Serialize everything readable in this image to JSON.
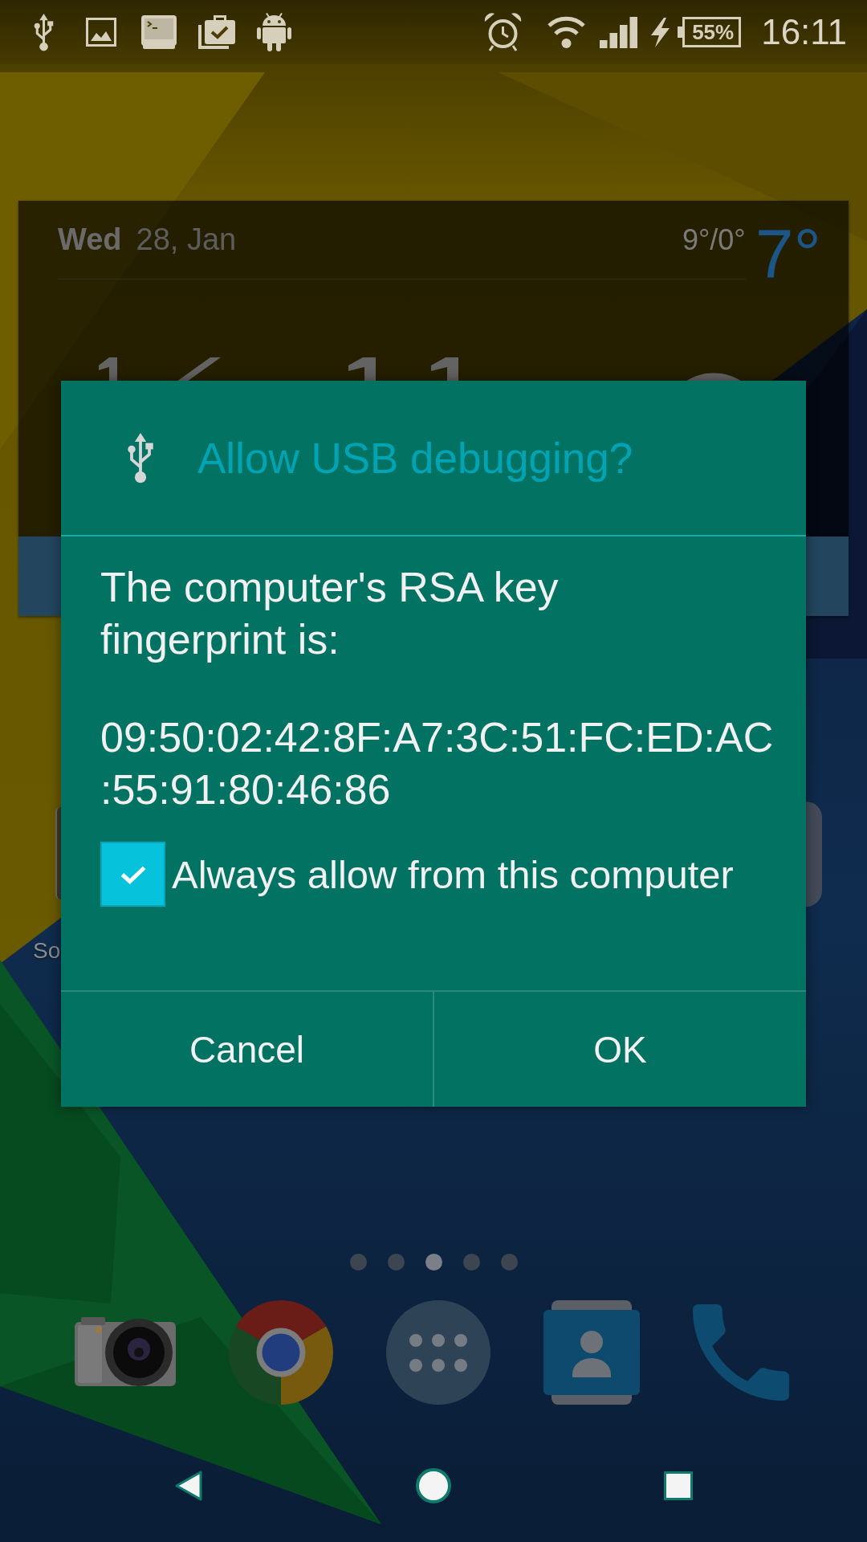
{
  "status_bar": {
    "battery": "55%",
    "time": "16:11"
  },
  "widget": {
    "day": "Wed",
    "date": "28, Jan",
    "temp_range": "9°/0°",
    "temperature": "7°"
  },
  "home": {
    "partial_label": "So",
    "page_indicator": [
      {
        "selected": false
      },
      {
        "selected": false
      },
      {
        "selected": true
      },
      {
        "selected": false
      },
      {
        "selected": false
      }
    ]
  },
  "dialog": {
    "title": "Allow USB debugging?",
    "message": "The computer's RSA key fingerprint is:",
    "fingerprint": "09:50:02:42:8F:A7:3C:51:FC:ED:AC:55:91:80:46:86",
    "checkbox": {
      "label": "Always allow from this computer",
      "checked": true
    },
    "buttons": [
      "Cancel",
      "OK"
    ]
  }
}
